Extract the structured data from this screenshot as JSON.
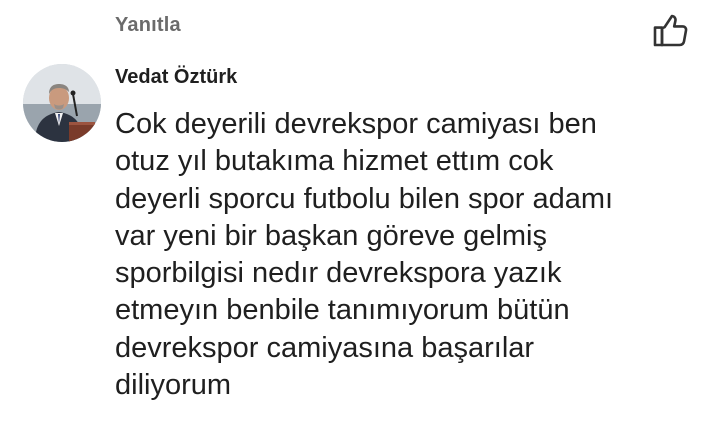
{
  "reply": {
    "label": "Yanıtla"
  },
  "like": {
    "icon": "thumbs-up-icon"
  },
  "author": {
    "name": "Vedat Öztürk",
    "avatar_icon": "user-avatar-photo"
  },
  "comment": {
    "lines": [
      "Cok deyerili devrekspor camiyası ben",
      "otuz yıl butakıma hizmet ettım cok",
      "deyerli sporcu futbolu bilen spor adamı",
      "var yeni bir başkan göreve gelmiş",
      "sporbilgisi nedır devrekspora yazık",
      "etmeyın benbile tanımıyorum bütün",
      "devrekspor camiyasına başarılar",
      "diliyorum"
    ]
  },
  "colors": {
    "secondary_text": "#6b6b6b",
    "primary_text": "#1f1f1f",
    "background": "#ffffff"
  }
}
